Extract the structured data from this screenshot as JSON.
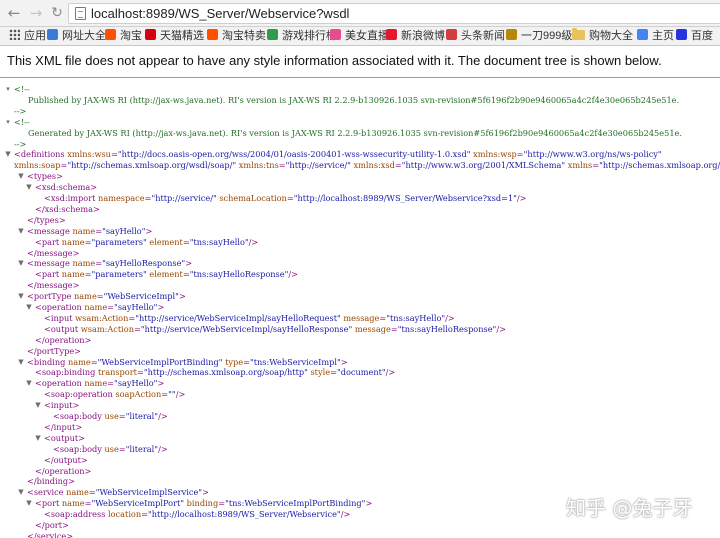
{
  "browser": {
    "url": "localhost:8989/WS_Server/Webservice?wsdl",
    "bookmarks": [
      {
        "label": "应用",
        "icon": "apps-grid-icon",
        "color": "#555555"
      },
      {
        "label": "网址大全",
        "icon": "bookmark-icon",
        "color": "#3a7bd5"
      },
      {
        "label": "淘宝",
        "icon": "bookmark-icon",
        "color": "#ff5000"
      },
      {
        "label": "天猫精选",
        "icon": "bookmark-icon",
        "color": "#d7000f"
      },
      {
        "label": "淘宝特卖",
        "icon": "bookmark-icon",
        "color": "#ff5000"
      },
      {
        "label": "游戏排行榜",
        "icon": "bookmark-icon",
        "color": "#2e9c4a"
      },
      {
        "label": "美女直播",
        "icon": "bookmark-icon",
        "color": "#e84c8a"
      },
      {
        "label": "新浪微博",
        "icon": "bookmark-icon",
        "color": "#e6162d"
      },
      {
        "label": "头条新闻",
        "icon": "bookmark-icon",
        "color": "#d43d3d"
      },
      {
        "label": "一刀999级",
        "icon": "bookmark-icon",
        "color": "#b8860b"
      },
      {
        "label": "购物大全",
        "icon": "folder-icon",
        "color": "#e8c25b"
      },
      {
        "label": "主页",
        "icon": "bookmark-icon",
        "color": "#4285f4"
      },
      {
        "label": "百度",
        "icon": "bookmark-icon",
        "color": "#2932e1"
      }
    ]
  },
  "page": {
    "info_message": "This XML file does not appear to have any style information associated with it. The document tree is shown below."
  },
  "xml_lines": [
    [
      {
        "k": "ct",
        "t": "<!--"
      }
    ],
    [
      {
        "k": "ct",
        "t": "Published by JAX-WS RI (http://jax-ws.java.net). RI's version is JAX-WS RI 2.2.9-b130926.1035 svn-revision#5f6196f2b90e9460065a4c2f4e30e065b245e51e."
      }
    ],
    [
      {
        "k": "ct",
        "t": "-->"
      }
    ],
    [
      {
        "k": "ct",
        "t": "<!--"
      }
    ],
    [
      {
        "k": "ct",
        "t": "Generated by JAX-WS RI (http://jax-ws.java.net). RI's version is JAX-WS RI 2.2.9-b130926.1035 svn-revision#5f6196f2b90e9460065a4c2f4e30e065b245e51e."
      }
    ],
    [
      {
        "k": "ct",
        "t": "-->"
      }
    ],
    [
      {
        "k": "tag",
        "t": "<definitions"
      },
      {
        "k": "an",
        "t": " xmlns:wsu"
      },
      {
        "k": "tag",
        "t": "="
      },
      {
        "k": "av",
        "t": "\"http://docs.oasis-open.org/wss/2004/01/oasis-200401-wss-wssecurity-utility-1.0.xsd\""
      },
      {
        "k": "an",
        "t": " xmlns:wsp"
      },
      {
        "k": "tag",
        "t": "="
      },
      {
        "k": "av",
        "t": "\"http://www.w3.org/ns/ws-policy\""
      }
    ],
    [
      {
        "k": "an",
        "t": "xmlns:soap"
      },
      {
        "k": "tag",
        "t": "="
      },
      {
        "k": "av",
        "t": "\"http://schemas.xmlsoap.org/wsdl/soap/\""
      },
      {
        "k": "an",
        "t": " xmlns:tns"
      },
      {
        "k": "tag",
        "t": "="
      },
      {
        "k": "av",
        "t": "\"http://service/\""
      },
      {
        "k": "an",
        "t": " xmlns:xsd"
      },
      {
        "k": "tag",
        "t": "="
      },
      {
        "k": "av",
        "t": "\"http://www.w3.org/2001/XMLSchema\""
      },
      {
        "k": "an",
        "t": " xmlns"
      },
      {
        "k": "tag",
        "t": "="
      },
      {
        "k": "av",
        "t": "\"http://schemas.xmlsoap.org/wsdl/\""
      }
    ],
    [
      {
        "k": "tag",
        "t": "<types>"
      }
    ],
    [
      {
        "k": "tag",
        "t": "<xsd:schema>"
      }
    ],
    [
      {
        "k": "tag",
        "t": "<xsd:import"
      },
      {
        "k": "an",
        "t": " namespace"
      },
      {
        "k": "tag",
        "t": "="
      },
      {
        "k": "av",
        "t": "\"http://service/\""
      },
      {
        "k": "an",
        "t": " schemaLocation"
      },
      {
        "k": "tag",
        "t": "="
      },
      {
        "k": "av",
        "t": "\"http://localhost:8989/WS_Server/Webservice?xsd=1\""
      },
      {
        "k": "tag",
        "t": "/>"
      }
    ],
    [
      {
        "k": "tag",
        "t": "</xsd:schema>"
      }
    ],
    [
      {
        "k": "tag",
        "t": "</types>"
      }
    ],
    [
      {
        "k": "tag",
        "t": "<message"
      },
      {
        "k": "an",
        "t": " name"
      },
      {
        "k": "tag",
        "t": "="
      },
      {
        "k": "av",
        "t": "\"sayHello\""
      },
      {
        "k": "tag",
        "t": ">"
      }
    ],
    [
      {
        "k": "tag",
        "t": "<part"
      },
      {
        "k": "an",
        "t": " name"
      },
      {
        "k": "tag",
        "t": "="
      },
      {
        "k": "av",
        "t": "\"parameters\""
      },
      {
        "k": "an",
        "t": " element"
      },
      {
        "k": "tag",
        "t": "="
      },
      {
        "k": "av",
        "t": "\"tns:sayHello\""
      },
      {
        "k": "tag",
        "t": "/>"
      }
    ],
    [
      {
        "k": "tag",
        "t": "</message>"
      }
    ],
    [
      {
        "k": "tag",
        "t": "<message"
      },
      {
        "k": "an",
        "t": " name"
      },
      {
        "k": "tag",
        "t": "="
      },
      {
        "k": "av",
        "t": "\"sayHelloResponse\""
      },
      {
        "k": "tag",
        "t": ">"
      }
    ],
    [
      {
        "k": "tag",
        "t": "<part"
      },
      {
        "k": "an",
        "t": " name"
      },
      {
        "k": "tag",
        "t": "="
      },
      {
        "k": "av",
        "t": "\"parameters\""
      },
      {
        "k": "an",
        "t": " element"
      },
      {
        "k": "tag",
        "t": "="
      },
      {
        "k": "av",
        "t": "\"tns:sayHelloResponse\""
      },
      {
        "k": "tag",
        "t": "/>"
      }
    ],
    [
      {
        "k": "tag",
        "t": "</message>"
      }
    ],
    [
      {
        "k": "tag",
        "t": "<portType"
      },
      {
        "k": "an",
        "t": " name"
      },
      {
        "k": "tag",
        "t": "="
      },
      {
        "k": "av",
        "t": "\"WebServiceImpl\""
      },
      {
        "k": "tag",
        "t": ">"
      }
    ],
    [
      {
        "k": "tag",
        "t": "<operation"
      },
      {
        "k": "an",
        "t": " name"
      },
      {
        "k": "tag",
        "t": "="
      },
      {
        "k": "av",
        "t": "\"sayHello\""
      },
      {
        "k": "tag",
        "t": ">"
      }
    ],
    [
      {
        "k": "tag",
        "t": "<input"
      },
      {
        "k": "an",
        "t": " wsam:Action"
      },
      {
        "k": "tag",
        "t": "="
      },
      {
        "k": "av",
        "t": "\"http://service/WebServiceImpl/sayHelloRequest\""
      },
      {
        "k": "an",
        "t": " message"
      },
      {
        "k": "tag",
        "t": "="
      },
      {
        "k": "av",
        "t": "\"tns:sayHello\""
      },
      {
        "k": "tag",
        "t": "/>"
      }
    ],
    [
      {
        "k": "tag",
        "t": "<output"
      },
      {
        "k": "an",
        "t": " wsam:Action"
      },
      {
        "k": "tag",
        "t": "="
      },
      {
        "k": "av",
        "t": "\"http://service/WebServiceImpl/sayHelloResponse\""
      },
      {
        "k": "an",
        "t": " message"
      },
      {
        "k": "tag",
        "t": "="
      },
      {
        "k": "av",
        "t": "\"tns:sayHelloResponse\""
      },
      {
        "k": "tag",
        "t": "/>"
      }
    ],
    [
      {
        "k": "tag",
        "t": "</operation>"
      }
    ],
    [
      {
        "k": "tag",
        "t": "</portType>"
      }
    ],
    [
      {
        "k": "tag",
        "t": "<binding"
      },
      {
        "k": "an",
        "t": " name"
      },
      {
        "k": "tag",
        "t": "="
      },
      {
        "k": "av",
        "t": "\"WebServiceImplPortBinding\""
      },
      {
        "k": "an",
        "t": " type"
      },
      {
        "k": "tag",
        "t": "="
      },
      {
        "k": "av",
        "t": "\"tns:WebServiceImpl\""
      },
      {
        "k": "tag",
        "t": ">"
      }
    ],
    [
      {
        "k": "tag",
        "t": "<soap:binding"
      },
      {
        "k": "an",
        "t": " transport"
      },
      {
        "k": "tag",
        "t": "="
      },
      {
        "k": "av",
        "t": "\"http://schemas.xmlsoap.org/soap/http\""
      },
      {
        "k": "an",
        "t": " style"
      },
      {
        "k": "tag",
        "t": "="
      },
      {
        "k": "av",
        "t": "\"document\""
      },
      {
        "k": "tag",
        "t": "/>"
      }
    ],
    [
      {
        "k": "tag",
        "t": "<operation"
      },
      {
        "k": "an",
        "t": " name"
      },
      {
        "k": "tag",
        "t": "="
      },
      {
        "k": "av",
        "t": "\"sayHello\""
      },
      {
        "k": "tag",
        "t": ">"
      }
    ],
    [
      {
        "k": "tag",
        "t": "<soap:operation"
      },
      {
        "k": "an",
        "t": " soapAction"
      },
      {
        "k": "tag",
        "t": "="
      },
      {
        "k": "av",
        "t": "\"\""
      },
      {
        "k": "tag",
        "t": "/>"
      }
    ],
    [
      {
        "k": "tag",
        "t": "<input>"
      }
    ],
    [
      {
        "k": "tag",
        "t": "<soap:body"
      },
      {
        "k": "an",
        "t": " use"
      },
      {
        "k": "tag",
        "t": "="
      },
      {
        "k": "av",
        "t": "\"literal\""
      },
      {
        "k": "tag",
        "t": "/>"
      }
    ],
    [
      {
        "k": "tag",
        "t": "</input>"
      }
    ],
    [
      {
        "k": "tag",
        "t": "<output>"
      }
    ],
    [
      {
        "k": "tag",
        "t": "<soap:body"
      },
      {
        "k": "an",
        "t": " use"
      },
      {
        "k": "tag",
        "t": "="
      },
      {
        "k": "av",
        "t": "\"literal\""
      },
      {
        "k": "tag",
        "t": "/>"
      }
    ],
    [
      {
        "k": "tag",
        "t": "</output>"
      }
    ],
    [
      {
        "k": "tag",
        "t": "</operation>"
      }
    ],
    [
      {
        "k": "tag",
        "t": "</binding>"
      }
    ],
    [
      {
        "k": "tag",
        "t": "<service"
      },
      {
        "k": "an",
        "t": " name"
      },
      {
        "k": "tag",
        "t": "="
      },
      {
        "k": "av",
        "t": "\"WebServiceImplService\""
      },
      {
        "k": "tag",
        "t": ">"
      }
    ],
    [
      {
        "k": "tag",
        "t": "<port"
      },
      {
        "k": "an",
        "t": " name"
      },
      {
        "k": "tag",
        "t": "="
      },
      {
        "k": "av",
        "t": "\"WebServiceImplPort\""
      },
      {
        "k": "an",
        "t": " binding"
      },
      {
        "k": "tag",
        "t": "="
      },
      {
        "k": "av",
        "t": "\"tns:WebServiceImplPortBinding\""
      },
      {
        "k": "tag",
        "t": ">"
      }
    ],
    [
      {
        "k": "tag",
        "t": "<soap:address"
      },
      {
        "k": "an",
        "t": " location"
      },
      {
        "k": "tag",
        "t": "="
      },
      {
        "k": "av",
        "t": "\"http://localhost:8989/WS_Server/Webservice\""
      },
      {
        "k": "tag",
        "t": "/>"
      }
    ],
    [
      {
        "k": "tag",
        "t": "</port>"
      }
    ],
    [
      {
        "k": "tag",
        "t": "</service>"
      }
    ]
  ],
  "watermark": "知乎 @兔子牙"
}
